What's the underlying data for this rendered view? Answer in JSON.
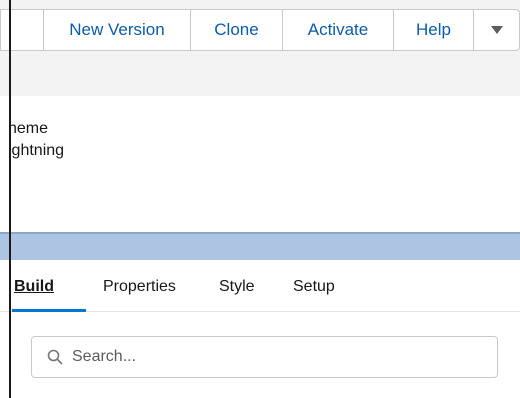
{
  "toolbar": {
    "buttons": [
      {
        "label": ""
      },
      {
        "label": "New Version"
      },
      {
        "label": "Clone"
      },
      {
        "label": "Activate"
      },
      {
        "label": "Help"
      }
    ],
    "menu_icon": "chevron-down-icon"
  },
  "info": {
    "line1": "heme",
    "line2": "ightning"
  },
  "tabs": [
    {
      "label": "Build",
      "active": true
    },
    {
      "label": "Properties",
      "active": false
    },
    {
      "label": "Style",
      "active": false
    },
    {
      "label": "Setup",
      "active": false
    }
  ],
  "search": {
    "placeholder": "Search...",
    "icon": "search-icon"
  },
  "colors": {
    "accent": "#0176d3",
    "link": "#0b5cab",
    "band": "#aec4e3"
  }
}
